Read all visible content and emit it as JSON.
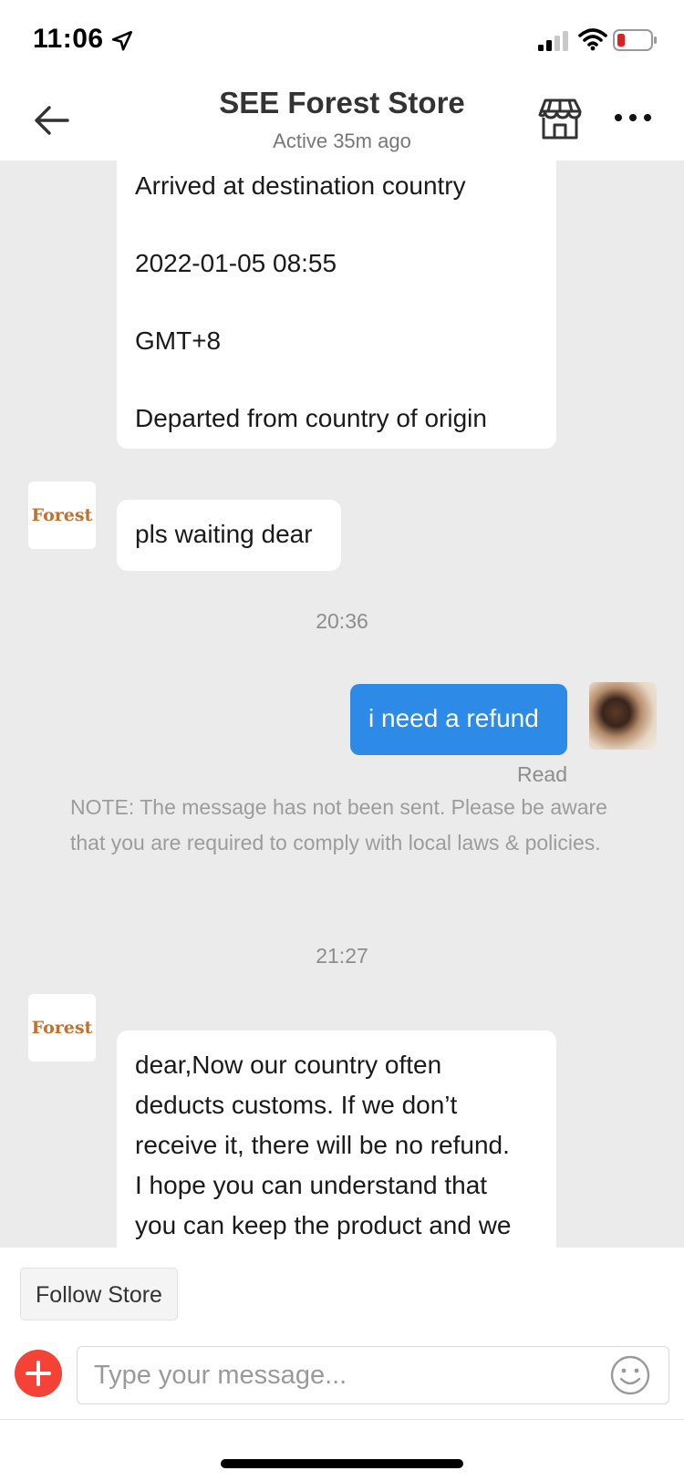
{
  "status_bar": {
    "time": "11:06",
    "icons": [
      "location-arrow-icon",
      "cellular-signal-icon",
      "wifi-icon",
      "battery-low-icon"
    ]
  },
  "header": {
    "title": "SEE Forest Store",
    "subtitle": "Active 35m ago",
    "icons": [
      "back-arrow-icon",
      "storefront-icon",
      "more-icon"
    ]
  },
  "messages": {
    "tracking_lines": [
      "Arrived at destination country",
      "2022-01-05 08:55",
      "GMT+8",
      "Departed from country of origin"
    ],
    "store_avatar_label": "Forest",
    "store_reply_1": "pls waiting dear",
    "timestamp_1": "20:36",
    "user_message": "i need a refund",
    "read_status": "Read",
    "note": "NOTE: The message has not been sent. Please be aware that you are required to comply with local laws & policies.",
    "timestamp_2": "21:27",
    "store_reply_2_lines": [
      "dear,Now our country often",
      "deducts customs. If we don’t",
      "receive it, there will be no refund.",
      "I hope you can understand that",
      "you can keep the product and we"
    ]
  },
  "footer": {
    "follow_label": "Follow Store",
    "input_placeholder": "Type your message...",
    "input_value": ""
  },
  "colors": {
    "sent_bubble": "#2d8ae6",
    "chat_background": "#ebebeb",
    "plus_button": "#f44336",
    "store_logo_text": "#c2702c"
  }
}
